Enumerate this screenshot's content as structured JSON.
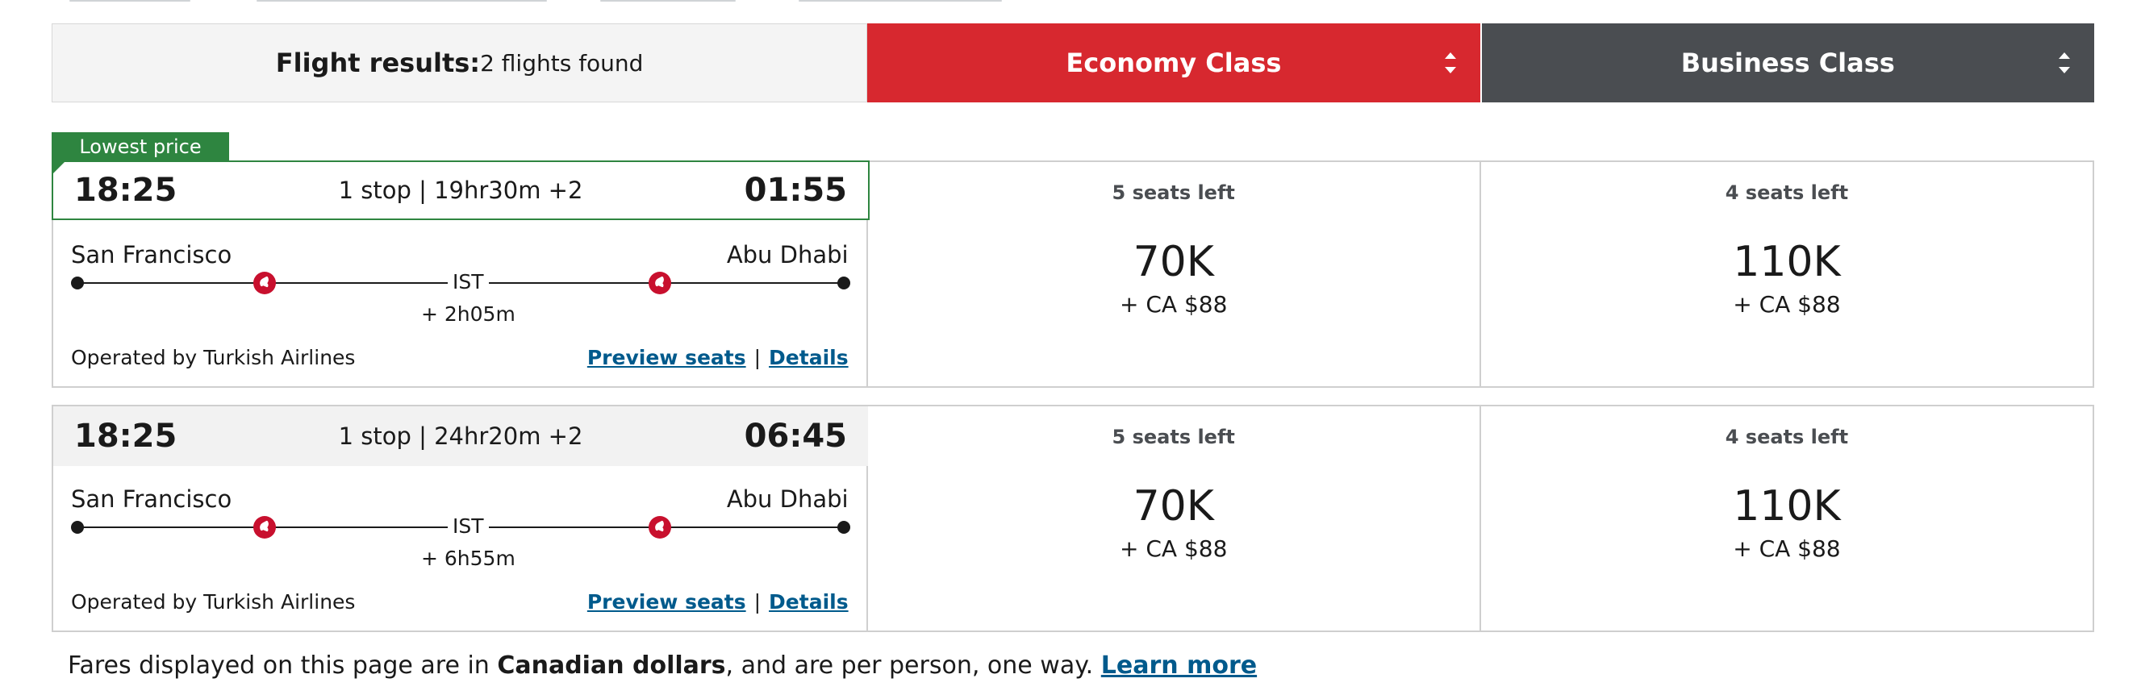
{
  "header": {
    "results_label": "Flight results:",
    "results_count": "2 flights found",
    "economy_label": "Economy Class",
    "business_label": "Business Class"
  },
  "badge": {
    "lowest_price": "Lowest price"
  },
  "flights": [
    {
      "depart_time": "18:25",
      "summary": "1 stop | 19hr30m +2",
      "arrive_time": "01:55",
      "origin": "San Francisco",
      "destination": "Abu Dhabi",
      "stop_code": "IST",
      "layover": "+ 2h05m",
      "operated_by": "Operated by Turkish Airlines",
      "preview_label": "Preview seats",
      "link_separator": "|",
      "details_label": "Details",
      "economy": {
        "seats": "5 seats left",
        "miles": "70K",
        "cash": "+ CA $88"
      },
      "business": {
        "seats": "4 seats left",
        "miles": "110K",
        "cash": "+ CA $88"
      }
    },
    {
      "depart_time": "18:25",
      "summary": "1 stop | 24hr20m +2",
      "arrive_time": "06:45",
      "origin": "San Francisco",
      "destination": "Abu Dhabi",
      "stop_code": "IST",
      "layover": "+ 6h55m",
      "operated_by": "Operated by Turkish Airlines",
      "preview_label": "Preview seats",
      "link_separator": "|",
      "details_label": "Details",
      "economy": {
        "seats": "5 seats left",
        "miles": "70K",
        "cash": "+ CA $88"
      },
      "business": {
        "seats": "4 seats left",
        "miles": "110K",
        "cash": "+ CA $88"
      }
    }
  ],
  "footer": {
    "text_before": "Fares displayed on this page are in ",
    "currency": "Canadian dollars",
    "text_after": ", and are per person, one way. ",
    "learn_more": "Learn more"
  },
  "colors": {
    "economy_header": "#d7282f",
    "business_header": "#4a4d51",
    "lowest_price_green": "#2e8540",
    "link_blue": "#005a8c",
    "carrier_red": "#c8102e"
  },
  "icons": [
    "sort-icon",
    "turkish-airlines-icon"
  ]
}
